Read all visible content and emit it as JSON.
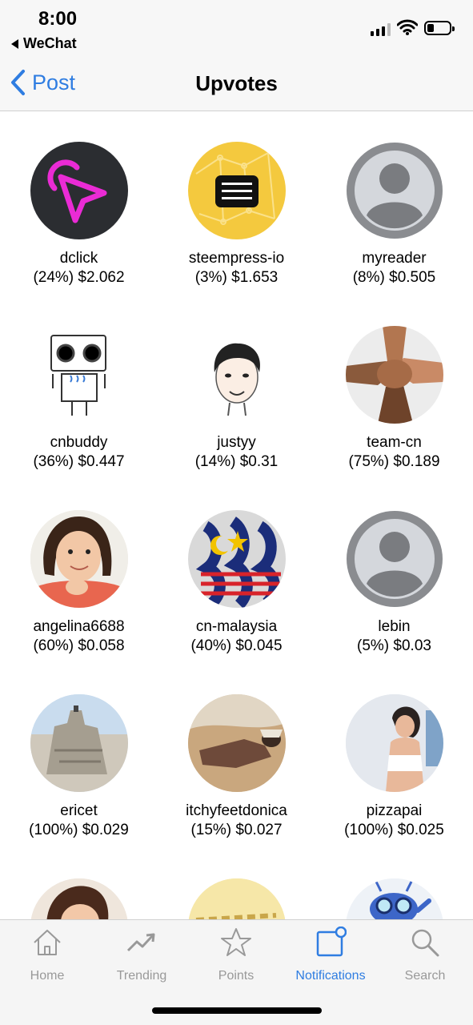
{
  "status": {
    "time": "8:00",
    "back_app": "WeChat"
  },
  "nav": {
    "back_label": "Post",
    "title": "Upvotes"
  },
  "voters": [
    {
      "name": "dclick",
      "value": "(24%) $2.062",
      "avatar": "dclick-logo"
    },
    {
      "name": "steempress-io",
      "value": "(3%) $1.653",
      "avatar": "steempress-logo"
    },
    {
      "name": "myreader",
      "value": "(8%) $0.505",
      "avatar": "default-person"
    },
    {
      "name": "cnbuddy",
      "value": "(36%) $0.447",
      "avatar": "robot"
    },
    {
      "name": "justyy",
      "value": "(14%) $0.31",
      "avatar": "cartoon-face"
    },
    {
      "name": "team-cn",
      "value": "(75%) $0.189",
      "avatar": "hands-photo"
    },
    {
      "name": "angelina6688",
      "value": "(60%) $0.058",
      "avatar": "child-photo"
    },
    {
      "name": "cn-malaysia",
      "value": "(40%) $0.045",
      "avatar": "malaysia-flag-logo"
    },
    {
      "name": "lebin",
      "value": "(5%) $0.03",
      "avatar": "default-person"
    },
    {
      "name": "ericet",
      "value": "(100%) $0.029",
      "avatar": "sandcastle-photo"
    },
    {
      "name": "itchyfeetdonica",
      "value": "(15%) $0.027",
      "avatar": "desert-photo"
    },
    {
      "name": "pizzapai",
      "value": "(100%) $0.025",
      "avatar": "woman-photo"
    }
  ],
  "tabs": [
    {
      "label": "Home",
      "icon": "home-icon"
    },
    {
      "label": "Trending",
      "icon": "trending-icon"
    },
    {
      "label": "Points",
      "icon": "star-icon"
    },
    {
      "label": "Notifications",
      "icon": "notification-icon"
    },
    {
      "label": "Search",
      "icon": "search-icon"
    }
  ],
  "colors": {
    "accent": "#2f7de1",
    "inactive": "#999999"
  }
}
